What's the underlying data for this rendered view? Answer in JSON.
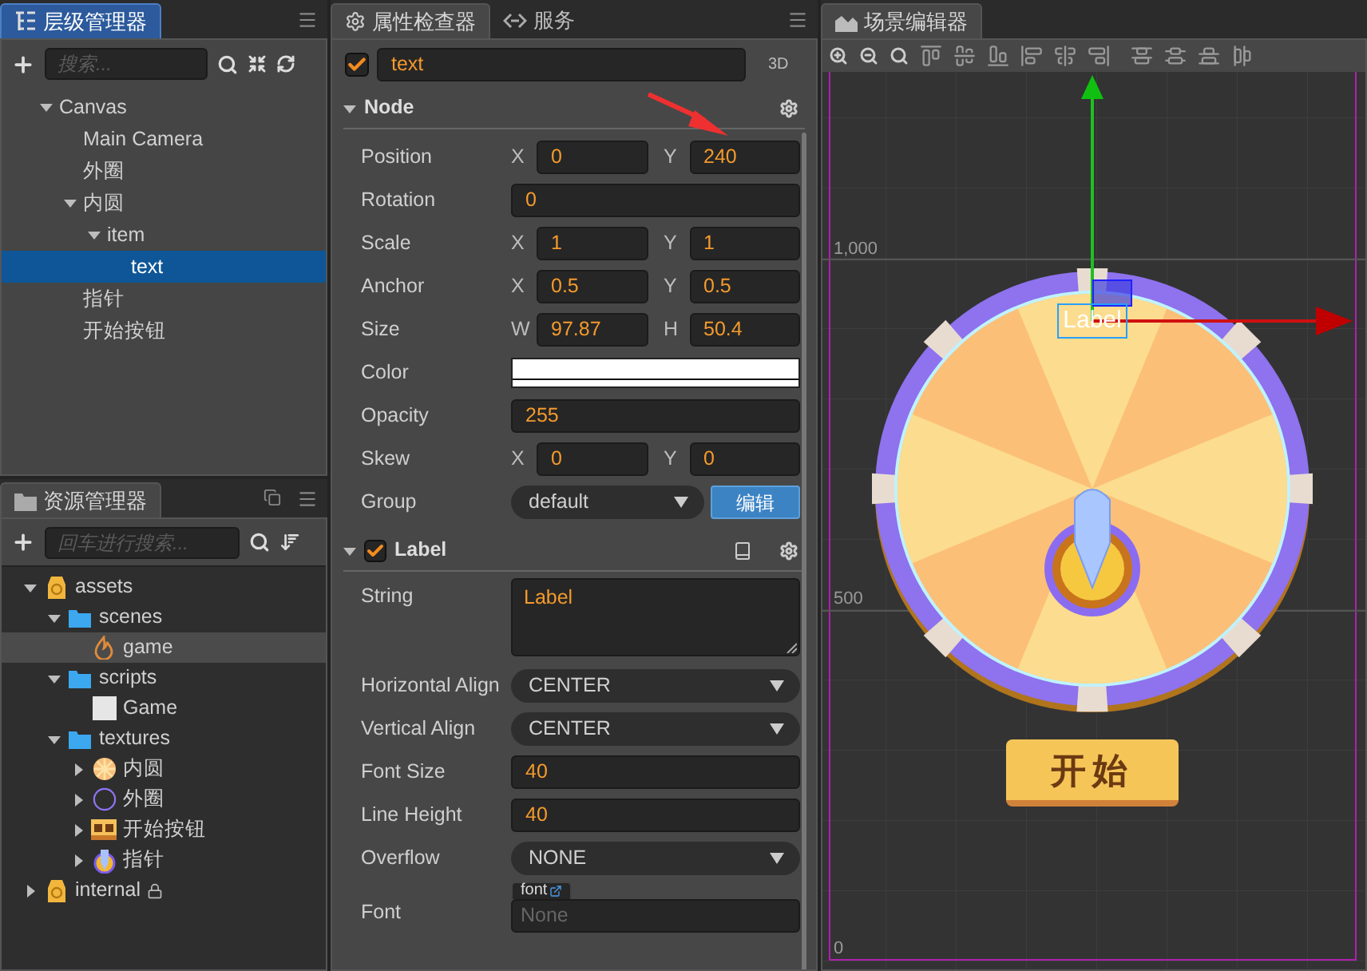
{
  "hierarchy": {
    "title": "层级管理器",
    "selected": true,
    "search_placeholder": "搜索...",
    "tree": [
      {
        "label": "Canvas",
        "expanded": true,
        "selected": false,
        "children": [
          {
            "label": "Main Camera",
            "selected": false
          },
          {
            "label": "外圈",
            "selected": false
          },
          {
            "label": "内圆",
            "expanded": true,
            "selected": false,
            "children": [
              {
                "label": "item",
                "expanded": true,
                "selected": false,
                "children": [
                  {
                    "label": "text",
                    "selected": true
                  }
                ]
              }
            ]
          },
          {
            "label": "指针",
            "selected": false
          },
          {
            "label": "开始按钮",
            "selected": false
          }
        ]
      }
    ]
  },
  "assets": {
    "title": "资源管理器",
    "selected": false,
    "search_placeholder": "回车进行搜索...",
    "tree": [
      {
        "label": "assets",
        "kind": "package",
        "expanded": true,
        "selected": false,
        "children": [
          {
            "label": "scenes",
            "kind": "folder",
            "expanded": true,
            "selected": false,
            "children": [
              {
                "label": "game",
                "kind": "scene",
                "selected": true
              }
            ]
          },
          {
            "label": "scripts",
            "kind": "folder",
            "expanded": true,
            "selected": false,
            "children": [
              {
                "label": "Game",
                "kind": "script",
                "selected": false
              }
            ]
          },
          {
            "label": "textures",
            "kind": "folder",
            "expanded": true,
            "selected": false,
            "children": [
              {
                "label": "内圆",
                "kind": "wheel-texture",
                "expanded": false,
                "selected": false
              },
              {
                "label": "外圈",
                "kind": "ring-texture",
                "expanded": false,
                "selected": false
              },
              {
                "label": "开始按钮",
                "kind": "button-texture",
                "expanded": false,
                "selected": false
              },
              {
                "label": "指针",
                "kind": "pointer-texture",
                "expanded": false,
                "selected": false
              }
            ]
          }
        ]
      },
      {
        "label": "internal",
        "kind": "package",
        "expanded": false,
        "selected": false,
        "locked": true
      }
    ]
  },
  "inspector": {
    "tabs": [
      {
        "label": "属性检查器",
        "selected": true
      },
      {
        "label": "服务",
        "selected": false
      }
    ],
    "node": {
      "active": true,
      "name": "text",
      "mode": "3D"
    },
    "sections": [
      {
        "title": "Node",
        "expanded": true,
        "properties": [
          {
            "label": "Position",
            "kind": "pair",
            "fields": [
              {
                "axis": "X",
                "value": "0"
              },
              {
                "axis": "Y",
                "value": "240"
              }
            ]
          },
          {
            "label": "Rotation",
            "kind": "number",
            "value": "0"
          },
          {
            "label": "Scale",
            "kind": "pair",
            "fields": [
              {
                "axis": "X",
                "value": "1"
              },
              {
                "axis": "Y",
                "value": "1"
              }
            ]
          },
          {
            "label": "Anchor",
            "kind": "pair",
            "fields": [
              {
                "axis": "X",
                "value": "0.5"
              },
              {
                "axis": "Y",
                "value": "0.5"
              }
            ]
          },
          {
            "label": "Size",
            "kind": "pair",
            "fields": [
              {
                "axis": "W",
                "value": "97.87"
              },
              {
                "axis": "H",
                "value": "50.4"
              }
            ]
          },
          {
            "label": "Color",
            "kind": "color",
            "color": "#ffffff"
          },
          {
            "label": "Opacity",
            "kind": "number",
            "value": "255"
          },
          {
            "label": "Skew",
            "kind": "pair",
            "fields": [
              {
                "axis": "X",
                "value": "0"
              },
              {
                "axis": "Y",
                "value": "0"
              }
            ]
          },
          {
            "label": "Group",
            "kind": "select",
            "value": "default",
            "button": "编辑"
          }
        ]
      },
      {
        "title": "Label",
        "expanded": true,
        "enabled": true,
        "properties": [
          {
            "label": "String",
            "kind": "textarea",
            "value": "Label"
          },
          {
            "label": "Horizontal Align",
            "kind": "select",
            "value": "CENTER"
          },
          {
            "label": "Vertical Align",
            "kind": "select",
            "value": "CENTER"
          },
          {
            "label": "Font Size",
            "kind": "number",
            "value": "40"
          },
          {
            "label": "Line Height",
            "kind": "number",
            "value": "40"
          },
          {
            "label": "Overflow",
            "kind": "select",
            "value": "NONE"
          },
          {
            "label": "Font",
            "kind": "asset",
            "tag": "font",
            "placeholder": "None"
          }
        ]
      }
    ]
  },
  "scene": {
    "title": "场景编辑器",
    "ruler_labels": [
      "1,000",
      "500",
      "0"
    ],
    "node_label": "Label",
    "start_button": "开始"
  }
}
